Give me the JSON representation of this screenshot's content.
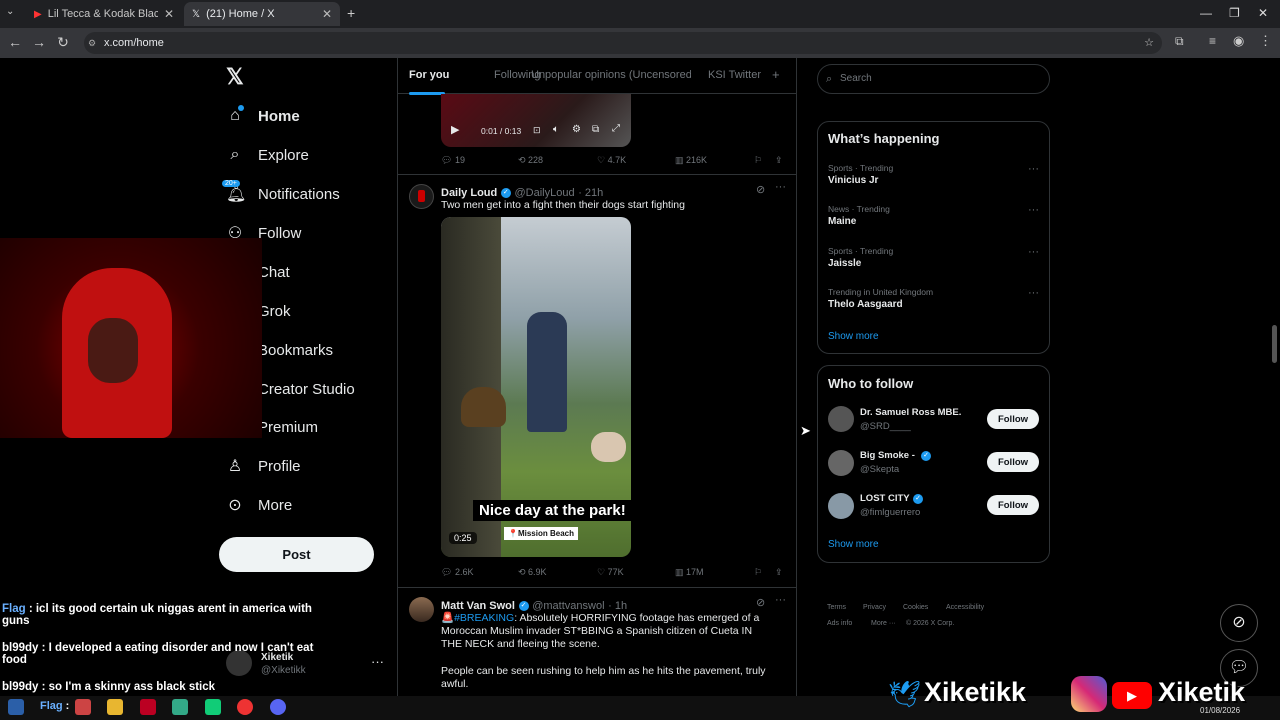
{
  "browser": {
    "tabs": [
      {
        "title": "Lil Tecca & Kodak Black - HVN I",
        "close": "✕"
      },
      {
        "title": "(21) Home / X",
        "close": "✕"
      }
    ],
    "url": "x.com/home",
    "new_tab": "+"
  },
  "nav": {
    "items": [
      {
        "label": "Home",
        "icon": "home-icon"
      },
      {
        "label": "Explore",
        "icon": "search-icon"
      },
      {
        "label": "Notifications",
        "icon": "bell-icon",
        "badge": "20+"
      },
      {
        "label": "Follow",
        "icon": "add-user-icon"
      },
      {
        "label": "Chat",
        "icon": "chat-icon"
      },
      {
        "label": "Grok",
        "icon": "grok-icon"
      },
      {
        "label": "Bookmarks",
        "icon": "bookmark-icon"
      },
      {
        "label": "Creator Studio",
        "icon": "bolt-icon"
      },
      {
        "label": "Premium",
        "icon": "x-icon"
      },
      {
        "label": "Profile",
        "icon": "person-icon"
      },
      {
        "label": "More",
        "icon": "more-circle-icon"
      }
    ],
    "post_label": "Post",
    "account_name": "Xiketik",
    "account_handle": "@Xiketikk"
  },
  "feed": {
    "tabs": [
      "For you",
      "Following",
      "Unpopular opinions (Uncensored",
      "KSI Twitter"
    ],
    "add_tab": "+",
    "video_time": "0:01 / 0:13",
    "top_tweet_stats": {
      "replies": "19",
      "reposts": "228",
      "likes": "4.7K",
      "views": "216K"
    },
    "tweets": [
      {
        "name": "Daily Loud",
        "handle": "@DailyLoud",
        "time": "· 21h",
        "text": "Two men get into a fight then their dogs start fighting",
        "media_caption": "Nice day at the park!",
        "media_location": "📍Mission Beach",
        "media_duration": "0:25",
        "replies": "2.6K",
        "reposts": "6.9K",
        "likes": "77K",
        "views": "17M"
      },
      {
        "name": "Matt Van Swol",
        "handle": "@mattvanswol",
        "time": "· 1h",
        "hashtag": "🚨#BREAKING",
        "text": ": Absolutely HORRIFYING footage has emerged of a Moroccan Muslim invader ST*BBING a Spanish citizen of Cueta IN THE NECK and fleeing the scene.",
        "text2": "People can be seen rushing to help him as he hits the pavement, truly awful."
      }
    ]
  },
  "right": {
    "search_placeholder": "Search",
    "happening_title": "What’s happening",
    "trends": [
      {
        "meta": "Sports · Trending",
        "name": "Vinicius Jr"
      },
      {
        "meta": "News · Trending",
        "name": "Maine"
      },
      {
        "meta": "Sports · Trending",
        "name": "Jaissle"
      },
      {
        "meta": "Trending in United Kingdom",
        "name": "Thelo Aasgaard"
      }
    ],
    "show_more": "Show more",
    "follow_title": "Who to follow",
    "follows": [
      {
        "name": "Dr. Samuel Ross MBE.",
        "handle": "@SRD____",
        "button": "Follow"
      },
      {
        "name": "Big Smoke -",
        "handle": "@Skepta",
        "button": "Follow"
      },
      {
        "name": "LOST CITY",
        "handle": "@fimlguerrero",
        "button": "Follow"
      }
    ],
    "footer": [
      "Terms",
      "Privacy",
      "Cookies",
      "Accessibility",
      "Ads info",
      "More ···",
      "© 2026 X Corp."
    ]
  },
  "stream": {
    "chat": [
      {
        "user": "Flag",
        "msg": " : icl its good certain uk niggas arent in america with guns"
      },
      {
        "user": "bl99dy",
        "msg": " : I developed a eating disorder and now I can't eat food"
      },
      {
        "user": "bl99dy",
        "msg": " : so I'm a skinny ass black stick"
      },
      {
        "user": "Flag",
        "msg": " :"
      }
    ],
    "brand1": "Xiketikk",
    "brand2": "Xiketik"
  },
  "taskbar": {
    "date": "01/08/2026"
  },
  "colors": {
    "accent": "#1d9bf0",
    "background": "#000000",
    "border": "#2f3336"
  }
}
